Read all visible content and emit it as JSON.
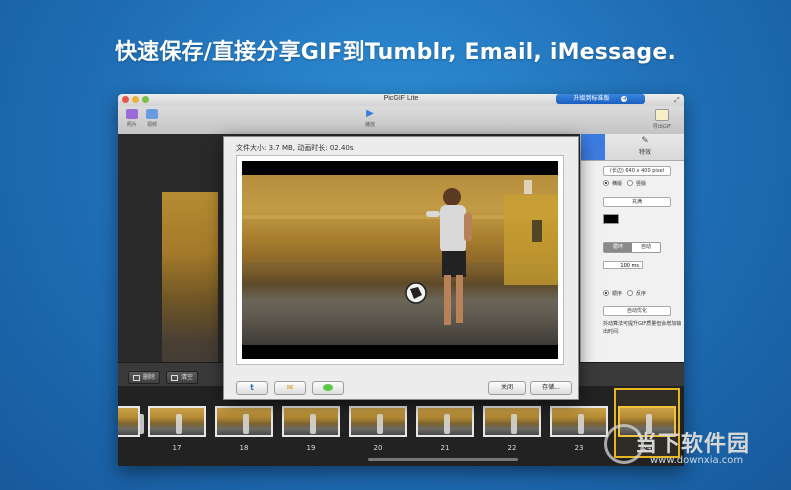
{
  "headline": "快速保存/直接分享GIF到Tumblr, Email, iMessage.",
  "window": {
    "title": "PicGIF Lite",
    "upgrade_label": "升级到标准版",
    "toolbar": {
      "add_label": "照片",
      "video_label": "视频",
      "play_label": "播放",
      "export_label": "导出GIF"
    }
  },
  "right_panel": {
    "tab_label": "特效",
    "size_select": "(长边) 640 x 400 pixel",
    "orientation": [
      "横版",
      "竖版"
    ],
    "fill_select": "充满",
    "loop_options": [
      "循环",
      "自动"
    ],
    "delay_value": "100 ms",
    "order_options": [
      "顺序",
      "反序"
    ],
    "optimize_select": "自动优化",
    "optimize_note": "抖动算法可提升GIF质量但会增加输出时间."
  },
  "controls": {
    "delete_label": "删除",
    "clear_label": "清空"
  },
  "frames": [
    "17",
    "18",
    "19",
    "20",
    "21",
    "22",
    "23",
    "24"
  ],
  "dialog": {
    "info": "文件大小: 3.7 MB, 动画时长: 02.40s",
    "close_label": "关闭",
    "save_label": "存储..."
  },
  "share_icons": [
    "tumblr-icon",
    "email-icon",
    "imessage-icon"
  ],
  "watermark": {
    "cn": "当下软件园",
    "url": "www.downxia.com"
  },
  "colors": {
    "background": "#1f6db5",
    "accent": "#3c7be0",
    "selection": "#e6b520"
  }
}
